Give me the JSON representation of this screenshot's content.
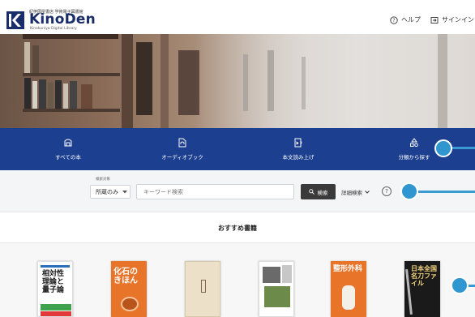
{
  "header": {
    "logo_tagline": "紀伊國屋書店 学術電子図書館",
    "logo_text": "KinoDen",
    "logo_subtext": "Kinokuniya Digital Library",
    "help_label": "ヘルプ",
    "signin_label": "サインイン"
  },
  "nav": {
    "items": [
      {
        "label": "すべての本",
        "icon": "book-icon"
      },
      {
        "label": "オーディオブック",
        "icon": "audiobook-icon"
      },
      {
        "label": "本文読み上げ",
        "icon": "read-aloud-icon"
      },
      {
        "label": "分類から探す",
        "icon": "category-icon"
      }
    ]
  },
  "search": {
    "scope_caption": "検索対象",
    "scope_value": "所蔵のみ",
    "placeholder": "キーワード検索",
    "button_label": "検索",
    "advanced_label": "詳細検索",
    "help_glyph": "?"
  },
  "recommended": {
    "title": "おすすめ書籍",
    "books": [
      {
        "cover_text": "相対性理論と量子論",
        "color": "#ffffff"
      },
      {
        "cover_text": "化石のきほん",
        "color": "#e8742a"
      },
      {
        "cover_text": "",
        "color": "#ece0c8"
      },
      {
        "cover_text": "",
        "color": "#ffffff"
      },
      {
        "cover_text": "整形外科",
        "color": "#e8742a"
      },
      {
        "cover_text": "日本全国名刀ファイル",
        "color": "#1a1a1a"
      }
    ]
  },
  "colors": {
    "brand_navy": "#1d3f8f",
    "search_button": "#3a3a3a",
    "callout_blue": "#2f96d0"
  }
}
